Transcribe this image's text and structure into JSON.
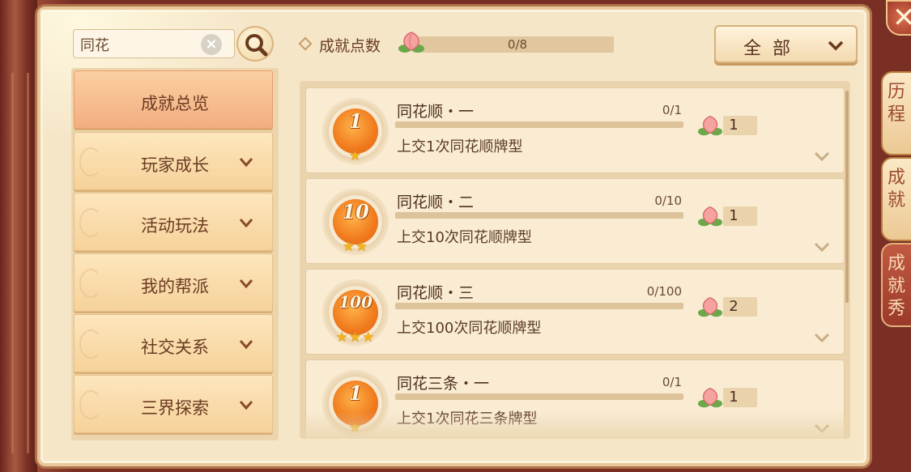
{
  "search": {
    "value": "同花"
  },
  "header": {
    "points_label": "成就点数",
    "points_progress": "0/8",
    "filter_label": "全部"
  },
  "sidebar": {
    "items": [
      {
        "label": "成就总览",
        "active": true,
        "expandable": false
      },
      {
        "label": "玩家成长",
        "active": false,
        "expandable": true
      },
      {
        "label": "活动玩法",
        "active": false,
        "expandable": true
      },
      {
        "label": "我的帮派",
        "active": false,
        "expandable": true
      },
      {
        "label": "社交关系",
        "active": false,
        "expandable": true
      },
      {
        "label": "三界探索",
        "active": false,
        "expandable": true
      }
    ]
  },
  "achievements": [
    {
      "medal": "1",
      "stars": "★",
      "title": "同花顺・一",
      "progress": "0/1",
      "desc": "上交1次同花顺牌型",
      "reward": "1"
    },
    {
      "medal": "10",
      "stars": "★★",
      "title": "同花顺・二",
      "progress": "0/10",
      "desc": "上交10次同花顺牌型",
      "reward": "1"
    },
    {
      "medal": "100",
      "stars": "★★★",
      "title": "同花顺・三",
      "progress": "0/100",
      "desc": "上交100次同花顺牌型",
      "reward": "2"
    },
    {
      "medal": "1",
      "stars": "★",
      "title": "同花三条・一",
      "progress": "0/1",
      "desc": "上交1次同花三条牌型",
      "reward": "1"
    }
  ],
  "right_tabs": [
    {
      "label": "历程",
      "active": false
    },
    {
      "label": "成就",
      "active": true
    },
    {
      "label": "成就秀",
      "active": false
    }
  ],
  "close": {
    "label": "✕"
  },
  "colors": {
    "panel_bg": "#f5e6c8",
    "accent_orange": "#f07a1c",
    "text_brown": "#6a3b22",
    "frame_red": "#7a2f25"
  }
}
